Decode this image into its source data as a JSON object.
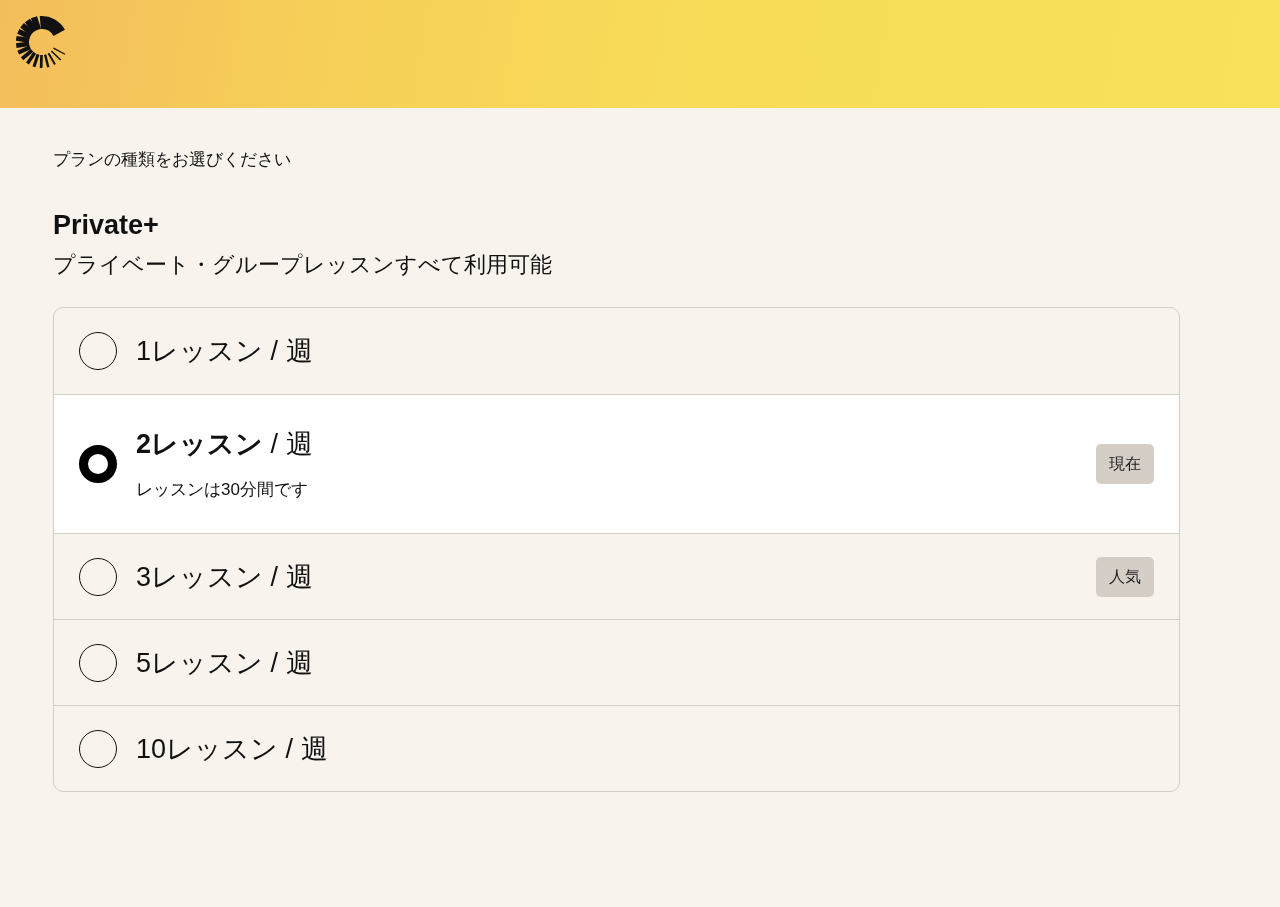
{
  "prompt": "プランの種類をお選びください",
  "plan": {
    "name": "Private+",
    "description": "プライベート・グループレッスンすべて利用可能"
  },
  "options": [
    {
      "count": "1レッスン",
      "unit": "/ 週",
      "selected": false
    },
    {
      "count": "2レッスン",
      "unit": "/ 週",
      "selected": true,
      "note": "レッスンは30分間です",
      "badge": "現在"
    },
    {
      "count": "3レッスン",
      "unit": "/ 週",
      "selected": false,
      "badge": "人気"
    },
    {
      "count": "5レッスン",
      "unit": "/ 週",
      "selected": false
    },
    {
      "count": "10レッスン",
      "unit": "/ 週",
      "selected": false
    }
  ]
}
